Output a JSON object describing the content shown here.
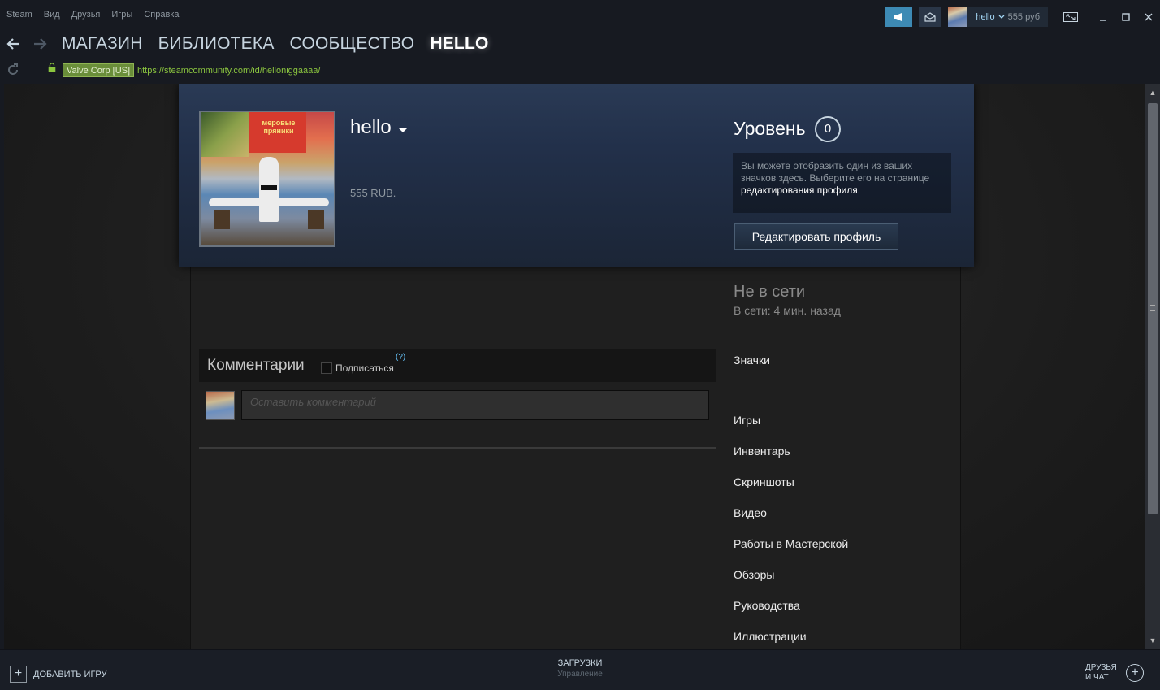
{
  "menu": {
    "items": [
      "Steam",
      "Вид",
      "Друзья",
      "Игры",
      "Справка"
    ]
  },
  "account": {
    "name": "hello",
    "balance": "555 руб"
  },
  "nav": {
    "links": [
      "МАГАЗИН",
      "БИБЛИОТЕКА",
      "СООБЩЕСТВО",
      "HELLO"
    ],
    "active": "HELLO"
  },
  "url": {
    "cert": "Valve Corp [US]",
    "address": "https://steamcommunity.com/id/helloniggaaaa/"
  },
  "profile": {
    "persona": "hello",
    "real_name": "555 RUB.",
    "level_label": "Уровень",
    "level": "0",
    "badge_text_1": "Вы можете отобразить один из ваших значков здесь. Выберите его на странице",
    "badge_link": "редактирования профиля",
    "badge_text_2": ".",
    "edit_button": "Редактировать профиль",
    "status": "Не в сети",
    "status_sub": "В сети: 4 мин. назад"
  },
  "comments": {
    "title": "Комментарии",
    "subscribe": "Подписаться",
    "help": "(?)",
    "placeholder": "Оставить комментарий"
  },
  "side_links": [
    {
      "label": "Значки"
    },
    {
      "label": "Игры"
    },
    {
      "label": "Инвентарь"
    },
    {
      "label": "Скриншоты"
    },
    {
      "label": "Видео"
    },
    {
      "label": "Работы в Мастерской"
    },
    {
      "label": "Обзоры"
    },
    {
      "label": "Руководства"
    },
    {
      "label": "Иллюстрации"
    }
  ],
  "bottom": {
    "add_game": "ДОБАВИТЬ ИГРУ",
    "downloads": "ЗАГРУЗКИ",
    "downloads_sub": "Управление",
    "friends_1": "ДРУЗЬЯ",
    "friends_2": "И ЧАТ"
  },
  "avatar_poster_text": "меровые пряники",
  "colors": {
    "accent": "#3d8ab4",
    "link": "#66c0f4",
    "url": "#8bc53f",
    "bg": "#171a21"
  }
}
